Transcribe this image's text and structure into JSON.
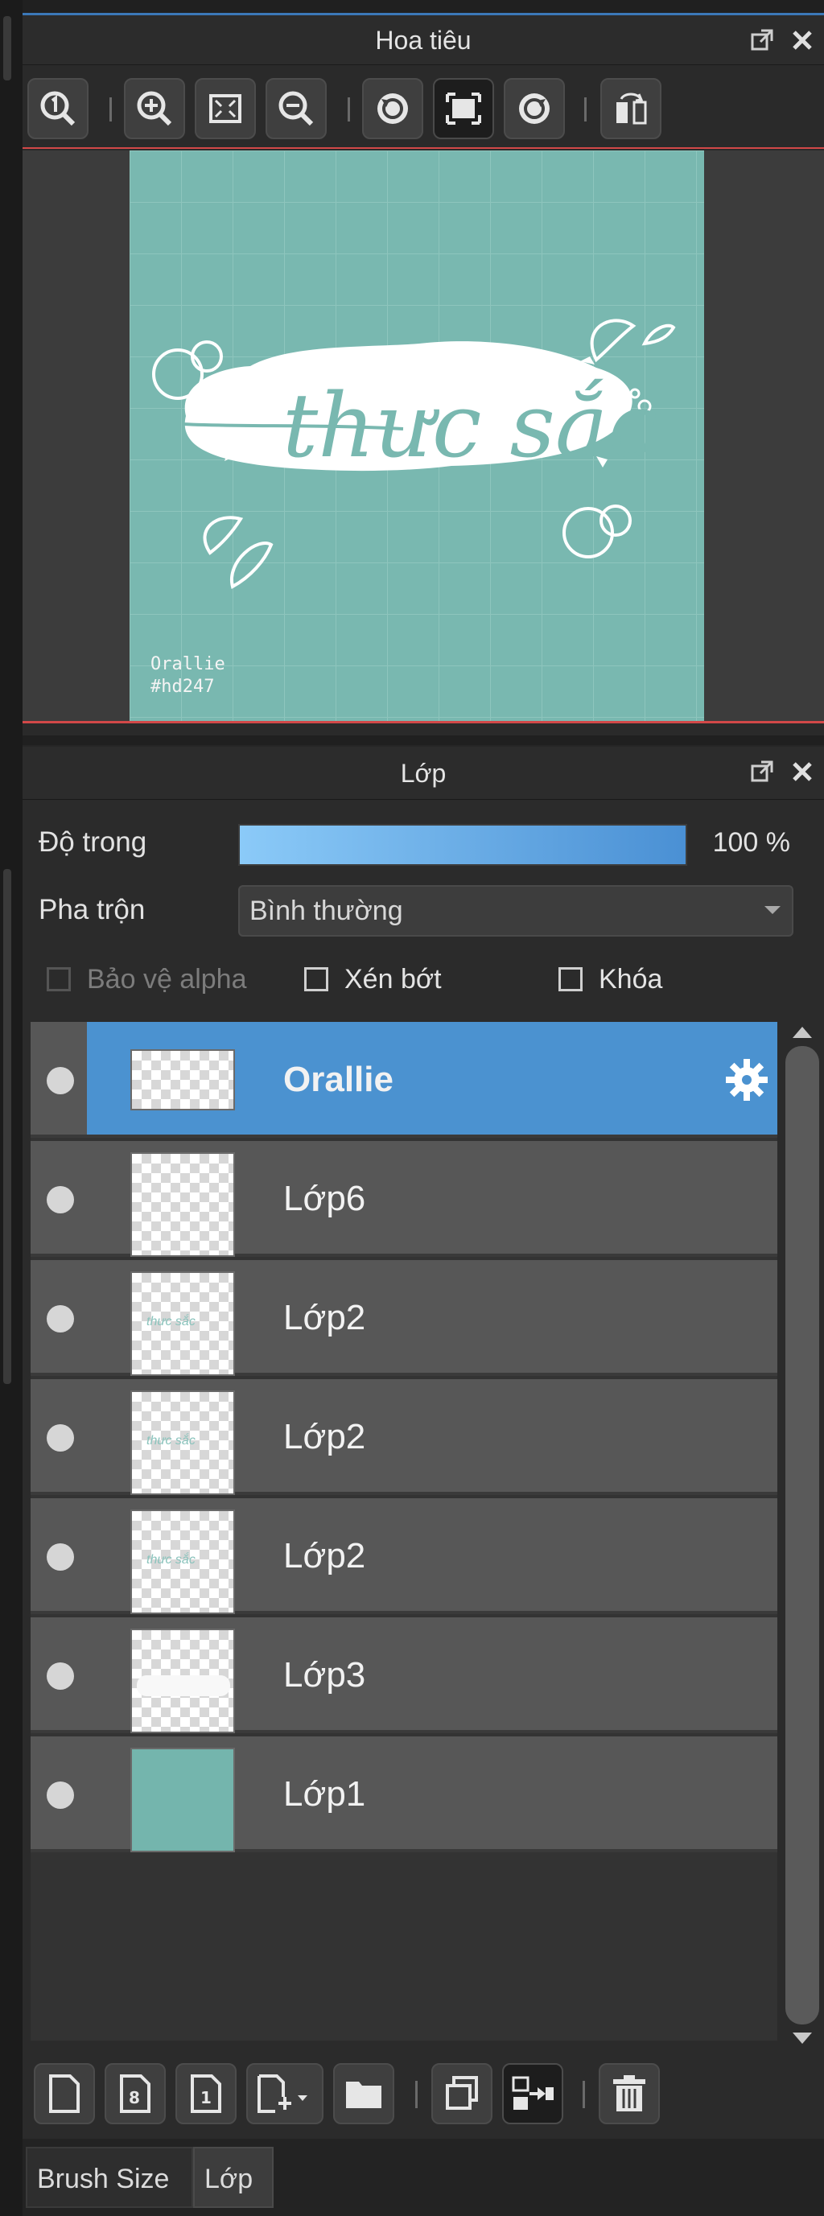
{
  "navigator": {
    "title": "Hoa tiêu",
    "toolbar": [
      {
        "name": "zoom-actual-size-button",
        "icon": "zoom-1-icon"
      },
      {
        "name": "zoom-in-button",
        "icon": "zoom-in-icon"
      },
      {
        "name": "fit-to-screen-button",
        "icon": "fit-screen-icon"
      },
      {
        "name": "zoom-out-button",
        "icon": "zoom-out-icon"
      },
      {
        "name": "rotate-left-button",
        "icon": "rotate-left-icon"
      },
      {
        "name": "reset-view-button",
        "icon": "reset-view-icon"
      },
      {
        "name": "rotate-right-button",
        "icon": "rotate-right-icon"
      },
      {
        "name": "flip-horizontal-button",
        "icon": "flip-icon"
      }
    ],
    "preview": {
      "artwork_text": "thưc sắc",
      "signature_line1": "Orallie",
      "signature_line2": "#hd247",
      "bg_color": "#79b8b0"
    }
  },
  "layers_panel": {
    "title": "Lớp",
    "opacity_label": "Độ trong",
    "opacity_value": "100 %",
    "opacity_fraction": 1.0,
    "blend_label": "Pha trộn",
    "blend_value": "Bình thường",
    "checks": {
      "alpha": "Bảo vệ alpha",
      "clip": "Xén bớt",
      "lock": "Khóa"
    },
    "layers": [
      {
        "name": "Orallie",
        "selected": true,
        "thumb": "transparent-wide"
      },
      {
        "name": "Lớp6",
        "selected": false,
        "thumb": "transparent"
      },
      {
        "name": "Lớp2",
        "selected": false,
        "thumb": "text"
      },
      {
        "name": "Lớp2",
        "selected": false,
        "thumb": "text"
      },
      {
        "name": "Lớp2",
        "selected": false,
        "thumb": "text"
      },
      {
        "name": "Lớp3",
        "selected": false,
        "thumb": "blob"
      },
      {
        "name": "Lớp1",
        "selected": false,
        "thumb": "teal"
      }
    ],
    "thumb_text": "thưc sắc",
    "accent_color": "#4b92d0"
  },
  "bottom_toolbar": [
    "new-layer-icon",
    "new-8bit-layer-icon",
    "new-1bit-layer-icon",
    "add-layer-menu-icon",
    "folder-icon",
    "duplicate-layer-icon",
    "merge-down-icon",
    "delete-layer-icon"
  ],
  "tabs": {
    "brush_size": "Brush Size",
    "layer": "Lớp"
  }
}
